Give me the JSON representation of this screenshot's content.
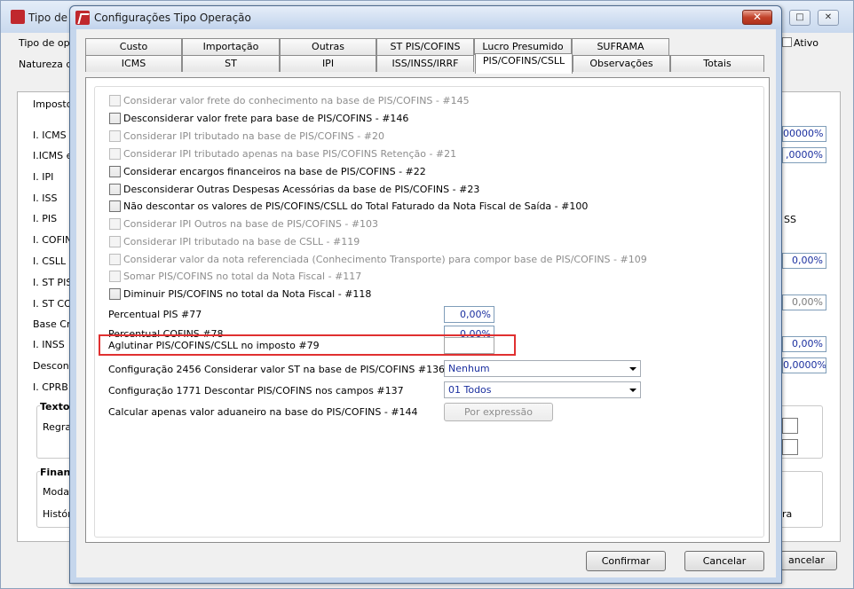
{
  "background_window": {
    "title": "Tipo de",
    "controls": [
      "□",
      "✕"
    ],
    "labels": {
      "tipo_de_ope": "Tipo de ope",
      "natureza": "Natureza d",
      "ativo": "Ativo",
      "imposto_tab": "Imposto",
      "icms": "I. ICMS",
      "icms_e": "I.ICMS e",
      "ipi": "I. IPI",
      "iss": "I. ISS",
      "pis": "I. PIS",
      "cofins": "I. COFIN",
      "csll": "I. CSLL",
      "st_pis": "I. ST PIS",
      "st_co": "I. ST CO",
      "base_cr": "Base Cre",
      "inss": "I. INSS",
      "descons": "Descons",
      "cprb": "I. CPRB",
      "texto": "Texto",
      "regra": "Regra",
      "finan": "Finan",
      "modal": "Modal",
      "histor": "Histór",
      "ss": "SS",
      "ra": "ra"
    },
    "values": {
      "v1": "00000%",
      "v2": ",0000%",
      "v3": "0,00%",
      "v4": "0,00%",
      "v5": "0,00%",
      "v6": "0,0000%"
    },
    "cancel_label": "ancelar"
  },
  "dialog": {
    "title": "Configurações Tipo Operação",
    "close_symbol": "✕",
    "tabs_row1": [
      "Custo",
      "Importação",
      "Outras",
      "ST PIS/COFINS",
      "Lucro Presumido",
      "SUFRAMA"
    ],
    "tabs_row2": [
      "ICMS",
      "ST",
      "IPI",
      "ISS/INSS/IRRF",
      "PIS/COFINS/CSLL",
      "Observações",
      "Totais"
    ],
    "active_tab": "PIS/COFINS/CSLL",
    "options": [
      {
        "label": "Considerar valor frete do conhecimento na base de PIS/COFINS - #145",
        "enabled": false
      },
      {
        "label": "Desconsiderar valor frete para base de PIS/COFINS - #146",
        "enabled": true
      },
      {
        "label": "Considerar IPI tributado na base de PIS/COFINS - #20",
        "enabled": false
      },
      {
        "label": "Considerar IPI tributado apenas na base PIS/COFINS Retenção - #21",
        "enabled": false
      },
      {
        "label": "Considerar encargos financeiros na base de PIS/COFINS - #22",
        "enabled": true
      },
      {
        "label": "Desconsiderar Outras Despesas Acessórias da base de PIS/COFINS - #23",
        "enabled": true
      },
      {
        "label": "Não descontar os valores de PIS/COFINS/CSLL do Total Faturado da Nota Fiscal de Saída - #100",
        "enabled": true
      },
      {
        "label": "Considerar IPI Outros na base de PIS/COFINS - #103",
        "enabled": false
      },
      {
        "label": "Considerar IPI tributado na base de CSLL - #119",
        "enabled": false
      },
      {
        "label": "Considerar valor da nota referenciada (Conhecimento Transporte) para compor base de PIS/COFINS - #109",
        "enabled": false
      },
      {
        "label": "Somar PIS/COFINS no total da Nota Fiscal - #117",
        "enabled": false
      },
      {
        "label": "Diminuir PIS/COFINS no total da Nota Fiscal - #118",
        "enabled": true
      }
    ],
    "fields": {
      "percentual_pis_label": "Percentual PIS #77",
      "percentual_pis_value": "0,00%",
      "percentual_cofins_label": "Percentual COFINS #78",
      "percentual_cofins_value": "0,00%",
      "aglutinar_label": "Aglutinar PIS/COFINS/CSLL no imposto #79",
      "aglutinar_value": "",
      "config_2456_label": "Configuração 2456 Considerar valor ST na base de PIS/COFINS #136",
      "config_2456_value": "Nenhum",
      "config_1771_label": "Configuração 1771 Descontar PIS/COFINS nos campos #137",
      "config_1771_value": "01 Todos",
      "calcular_label": "Calcular apenas valor aduaneiro na base do PIS/COFINS - #144",
      "calcular_button": "Por expressão"
    },
    "buttons": {
      "confirm": "Confirmar",
      "cancel": "Cancelar"
    },
    "highlight_color": "#e03030"
  }
}
